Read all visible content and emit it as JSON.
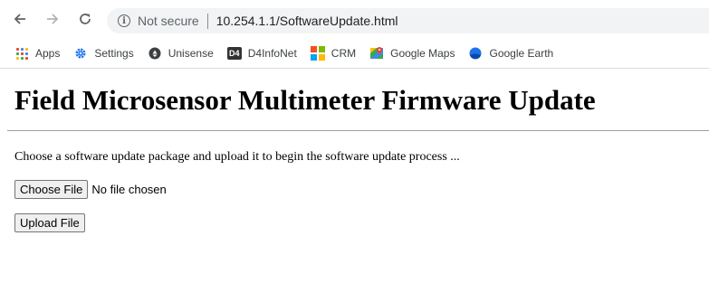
{
  "browser": {
    "security_label": "Not secure",
    "url": "10.254.1.1/SoftwareUpdate.html"
  },
  "bookmarks": [
    {
      "label": "Apps",
      "icon": "apps-grid-icon"
    },
    {
      "label": "Settings",
      "icon": "settings-gear-icon"
    },
    {
      "label": "Unisense",
      "icon": "unisense-icon"
    },
    {
      "label": "D4InfoNet",
      "icon": "d4-icon",
      "icon_text": "D4"
    },
    {
      "label": "CRM",
      "icon": "crm-windows-icon"
    },
    {
      "label": "Google Maps",
      "icon": "google-maps-icon"
    },
    {
      "label": "Google Earth",
      "icon": "google-earth-icon"
    }
  ],
  "page": {
    "title": "Field Microsensor Multimeter Firmware Update",
    "description": "Choose a software update package and upload it to begin the software update process ...",
    "choose_file_label": "Choose File",
    "file_status": "No file chosen",
    "upload_label": "Upload File"
  },
  "colors": {
    "chrome_icon": "#5f6368",
    "omnibox_bg": "#f1f3f4",
    "settings_icon": "#1a73e8",
    "crm_tiles": [
      "#f25022",
      "#7fba00",
      "#00a4ef",
      "#ffb900"
    ]
  }
}
